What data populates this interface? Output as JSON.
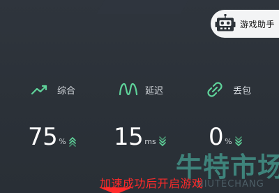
{
  "assistant": {
    "label": "游戏助手",
    "icon": "robot-icon"
  },
  "metrics": [
    {
      "label": "综合",
      "value": "75",
      "unit": "%",
      "icon": "trend-line-icon",
      "trend_icon": "double-chevron-up-icon"
    },
    {
      "label": "延迟",
      "value": "15",
      "unit": "ms",
      "icon": "wave-icon",
      "trend_icon": "double-chevron-down-icon"
    },
    {
      "label": "丢包",
      "value": "0",
      "unit": "%",
      "icon": "link-icon",
      "trend_icon": "double-chevron-down-icon"
    }
  ],
  "notice": "加速成功后开启游戏",
  "watermark": {
    "text": "牛特市场",
    "sub": "NIUTECHANG"
  },
  "colors": {
    "background": "#2c3239",
    "accent": "#5fd39a",
    "notice": "#ff2a2a",
    "pill": "#f3f4f5"
  }
}
